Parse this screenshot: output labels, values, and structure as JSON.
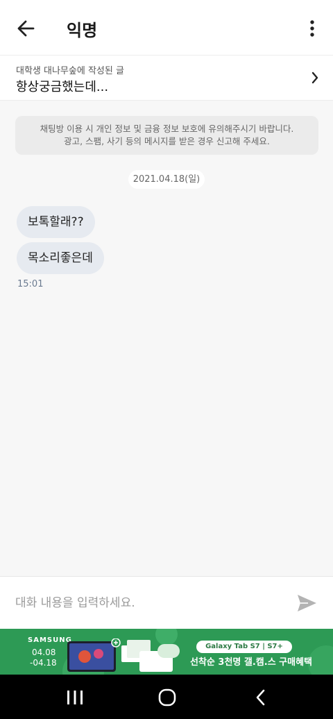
{
  "header": {
    "title": "익명",
    "back_icon": "arrow-left-icon",
    "more_icon": "more-vertical-icon"
  },
  "post": {
    "source": "대학생 대나무숲에 작성된 글",
    "title": "항상궁금했는데..."
  },
  "notice": {
    "line1": "채팅방 이용 시 개인 정보 및 금융 정보 보호에 유의해주시기 바랍니다.",
    "line2": "광고, 스팸, 사기 등의 메시지를 받은 경우 신고해 주세요."
  },
  "chat": {
    "date": "2021.04.18(일)",
    "messages": [
      {
        "text": "보톡할래??"
      },
      {
        "text": "목소리좋은데"
      }
    ],
    "time": "15:01"
  },
  "composer": {
    "placeholder": "대화 내용을 입력하세요.",
    "value": "",
    "send_icon": "send-icon"
  },
  "ad": {
    "brand": "SAMSUNG",
    "date_start": "04.08",
    "date_end": "-04.18",
    "product": "Galaxy Tab S7 | S7+",
    "headline": "선착순 3천명 갤.캠.스 구매혜택",
    "color": "#2d9a55"
  },
  "nav": {
    "recent_icon": "recent-apps-icon",
    "home_icon": "home-icon",
    "back_icon": "back-icon"
  },
  "colors": {
    "bubble": "#e6eaf0",
    "background": "#f7f7f7",
    "time": "#6a7a90"
  }
}
